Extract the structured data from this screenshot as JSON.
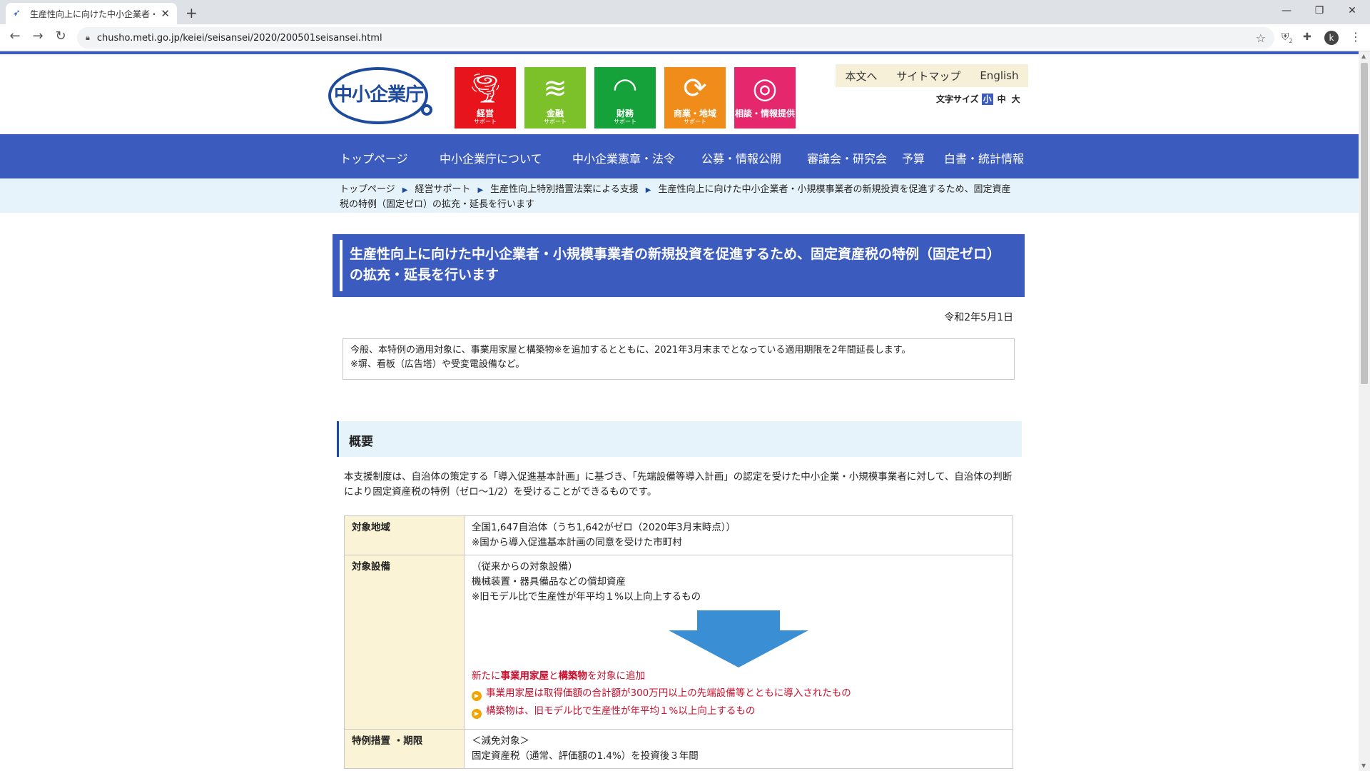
{
  "browser": {
    "tab_title": "生産性向上に向けた中小企業者・小",
    "url": "chusho.meti.go.jp/keiei/seisansei/2020/200501seisansei.html",
    "profile_initial": "k",
    "ext_badge": "2"
  },
  "header": {
    "logo_text": "中小企業庁",
    "tiles": [
      {
        "label": "経営",
        "sub": "サポート",
        "color": "#e8141c"
      },
      {
        "label": "金融",
        "sub": "サポート",
        "color": "#7cc02a"
      },
      {
        "label": "財務",
        "sub": "サポート",
        "color": "#16a23a"
      },
      {
        "label": "商業・地域",
        "sub": "サポート",
        "color": "#f08c1a"
      },
      {
        "label": "相談・情報提供",
        "sub": "",
        "color": "#e5286e"
      }
    ],
    "util_links": [
      "本文へ",
      "サイトマップ",
      "English"
    ],
    "font_size_label": "文字サイズ",
    "font_size_options": [
      "小",
      "中",
      "大"
    ]
  },
  "nav": {
    "items": [
      "トップページ",
      "中小企業庁について",
      "中小企業憲章・法令",
      "公募・情報公開",
      "審議会・研究会",
      "予算",
      "白書・統計情報"
    ]
  },
  "breadcrumb": {
    "items": [
      "トップページ",
      "経営サポート",
      "生産性向上特別措置法案による支援",
      "生産性向上に向けた中小企業者・小規模事業者の新規投資を促進するため、固定資産税の特例（固定ゼロ）の拡充・延長を行います"
    ]
  },
  "page": {
    "title": "生産性向上に向けた中小企業者・小規模事業者の新規投資を促進するため、固定資産税の特例（固定ゼロ）の拡充・延長を行います",
    "date": "令和2年5月1日",
    "notice_line1": "今般、本特例の適用対象に、事業用家屋と構築物※を追加するとともに、2021年3月末までとなっている適用期限を2年間延長します。",
    "notice_line2": "※塀、看板（広告塔）や受変電設備など。",
    "section_title": "概要",
    "summary": "本支援制度は、自治体の策定する「導入促進基本計画」に基づき、「先端設備等導入計画」の認定を受けた中小企業・小規模事業者に対して、自治体の判断により固定資産税の特例（ゼロ〜1/2）を受けることができるものです。"
  },
  "table": {
    "row1_head": "対象地域",
    "row1_line1": "全国1,647自治体（うち1,642がゼロ（2020年3月末時点））",
    "row1_line2": "※国から導入促進基本計画の同意を受けた市町村",
    "row2_head": "対象設備",
    "row2_line1": "（従来からの対象設備）",
    "row2_line2": "機械装置・器具備品などの償却資産",
    "row2_line3": "※旧モデル比で生産性が年平均１%以上向上するもの",
    "row2_new_prefix": "新たに",
    "row2_new_b1": "事業用家屋",
    "row2_new_and": "と",
    "row2_new_b2": "構築物",
    "row2_new_suffix": "を対象に追加",
    "row2_bullet1": "事業用家屋は取得価額の合計額が300万円以上の先端設備等とともに導入されたもの",
    "row2_bullet2": "構築物は、旧モデル比で生産性が年平均１%以上向上するもの",
    "row3_head": "特例措置 ・期限",
    "row3_line1": "＜減免対象＞",
    "row3_line2": "固定資産税（通常、評価額の1.4%）を投資後３年間"
  }
}
